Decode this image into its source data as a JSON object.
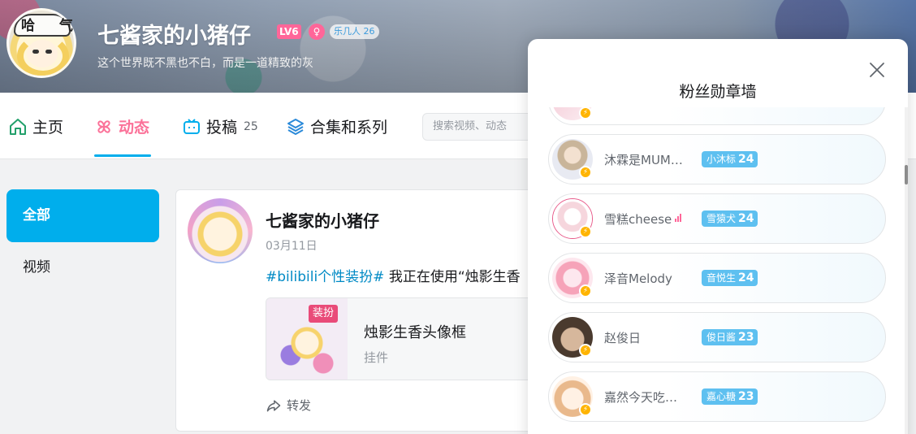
{
  "profile": {
    "avatar_text": "哈 气",
    "name": "七酱家的小猪仔",
    "level_badge": "LV6",
    "fans_badge": "乐几人 26",
    "signature": "这个世界既不黑也不白，而是一道精致的灰"
  },
  "nav": {
    "home": "主页",
    "dynamic": "动态",
    "upload": "投稿",
    "upload_count": "25",
    "collection": "合集和系列",
    "search_placeholder": "搜索视频、动态"
  },
  "sidebar": {
    "items": [
      {
        "label": "全部"
      },
      {
        "label": "视频"
      }
    ]
  },
  "feed": {
    "name": "七酱家的小猪仔",
    "date": "03月11日",
    "tag": "#bilibili个性装扮#",
    "text": " 我正在使用“烛影生香",
    "deco_tag": "装扮",
    "deco_title": "烛影生香头像框",
    "deco_sub": "挂件",
    "forward_label": "转发"
  },
  "modal": {
    "title": "粉丝勋章墙",
    "rows": [
      {
        "name": "沐霖是MUM…",
        "medal": "小沐标",
        "level": "24",
        "signal": false,
        "color1": "#c9b59a",
        "color2": "#e8eaf2"
      },
      {
        "name": "雪糕cheese",
        "medal": "雪猿犬",
        "level": "24",
        "signal": true,
        "color1": "#f6d6dd",
        "color2": "#ffffff"
      },
      {
        "name": "泽音Melody",
        "medal": "音悦生",
        "level": "24",
        "signal": false,
        "color1": "#f6a3b9",
        "color2": "#fde7ee"
      },
      {
        "name": "赵俊日",
        "medal": "俊日酱",
        "level": "23",
        "signal": false,
        "color1": "#4a3a2e",
        "color2": "#d6b79c"
      },
      {
        "name": "嘉然今天吃…",
        "medal": "嘉心糖",
        "level": "23",
        "signal": false,
        "color1": "#e9b98c",
        "color2": "#fff1e4"
      }
    ]
  },
  "colors": {
    "accent": "#00aeec",
    "pink": "#fb7299",
    "medal": "#5ec0f0"
  }
}
